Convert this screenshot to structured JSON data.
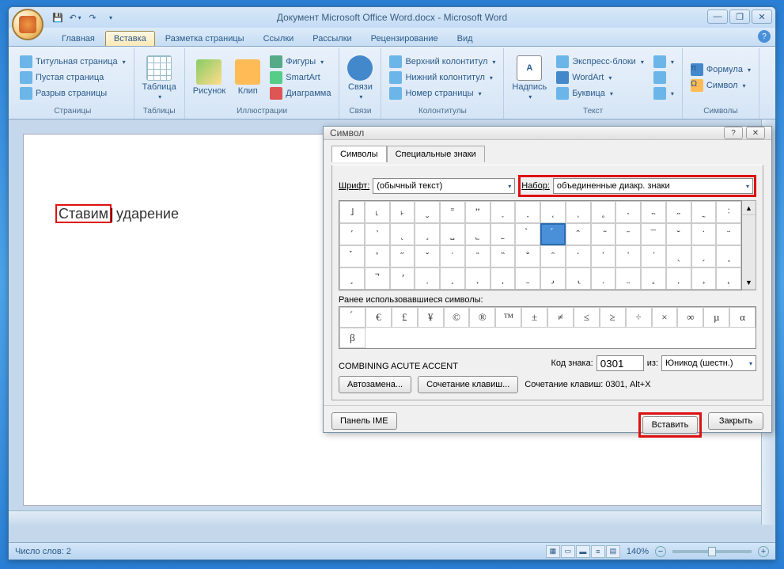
{
  "window": {
    "title": "Документ Microsoft Office Word.docx - Microsoft Word"
  },
  "tabs": {
    "home": "Главная",
    "insert": "Вставка",
    "layout": "Разметка страницы",
    "refs": "Ссылки",
    "mail": "Рассылки",
    "review": "Рецензирование",
    "view": "Вид"
  },
  "ribbon": {
    "pages": {
      "label": "Страницы",
      "cover": "Титульная страница",
      "blank": "Пустая страница",
      "break": "Разрыв страницы"
    },
    "tables": {
      "label": "Таблицы",
      "table": "Таблица"
    },
    "illus": {
      "label": "Иллюстрации",
      "pic": "Рисунок",
      "clip": "Клип",
      "shapes": "Фигуры",
      "smartart": "SmartArt",
      "chart": "Диаграмма"
    },
    "links": {
      "label": "Связи",
      "links_btn": "Связи"
    },
    "header": {
      "label": "Колонтитулы",
      "top": "Верхний колонтитул",
      "bottom": "Нижний колонтитул",
      "page": "Номер страницы"
    },
    "text": {
      "label": "Текст",
      "textbox": "Надпись",
      "quick": "Экспресс-блоки",
      "wordart": "WordArt",
      "dropcap": "Буквица"
    },
    "symbols": {
      "label": "Символы",
      "formula": "Формула",
      "symbol": "Символ"
    }
  },
  "document": {
    "word1": "Ставим",
    "word2": " ударение"
  },
  "status": {
    "wordcount": "Число слов: 2",
    "zoom": "140%"
  },
  "dialog": {
    "title": "Символ",
    "tab_symbols": "Символы",
    "tab_special": "Специальные знаки",
    "font_label": "Шрифт:",
    "font_value": "(обычный текст)",
    "set_label": "Набор:",
    "set_value": "объединенные диакр. знаки",
    "recent_label": "Ранее использовавшиеся символы:",
    "char_name": "COMBINING ACUTE ACCENT",
    "code_label": "Код знака:",
    "code_value": "0301",
    "from_label": "из:",
    "from_value": "Юникод (шестн.)",
    "autocorrect": "Автозамена...",
    "shortcut_btn": "Сочетание клавиш...",
    "shortcut_text": "Сочетание клавиш: 0301, Alt+X",
    "ime_panel": "Панель IME",
    "insert": "Вставить",
    "close": "Закрыть",
    "grid_row1": [
      "˩",
      "˪",
      "˫",
      "ˬ",
      "˭",
      "ˮ",
      "˯",
      "˰",
      "˱",
      "˲",
      "˳",
      "˴",
      "˵",
      "˶",
      "˷",
      "˸"
    ],
    "grid_row2": [
      "˹",
      "˺",
      "˻",
      "˼",
      "˽",
      "˾",
      "˿",
      "̀",
      "́",
      "̂",
      "̃",
      "̄",
      "̅",
      "̆",
      "̇",
      "̈"
    ],
    "grid_row3": [
      "̉",
      "̊",
      "̋",
      "̌",
      "̍",
      "̎",
      "̏",
      "̐",
      "̑",
      "̒",
      "̓",
      "̔",
      "̕",
      "̖",
      "̗",
      "̘"
    ],
    "grid_row4": [
      "̙",
      "̚",
      "̛",
      "̜",
      "̝",
      "̞",
      "̟",
      "̠",
      "̡",
      "̢",
      "̣",
      "̤",
      "̥",
      "̦",
      "̧",
      "̨"
    ],
    "selected_index": 24,
    "recent": [
      "́",
      "€",
      "£",
      "¥",
      "©",
      "®",
      "™",
      "±",
      "≠",
      "≤",
      "≥",
      "÷",
      "×",
      "∞",
      "µ",
      "α",
      "β"
    ]
  }
}
